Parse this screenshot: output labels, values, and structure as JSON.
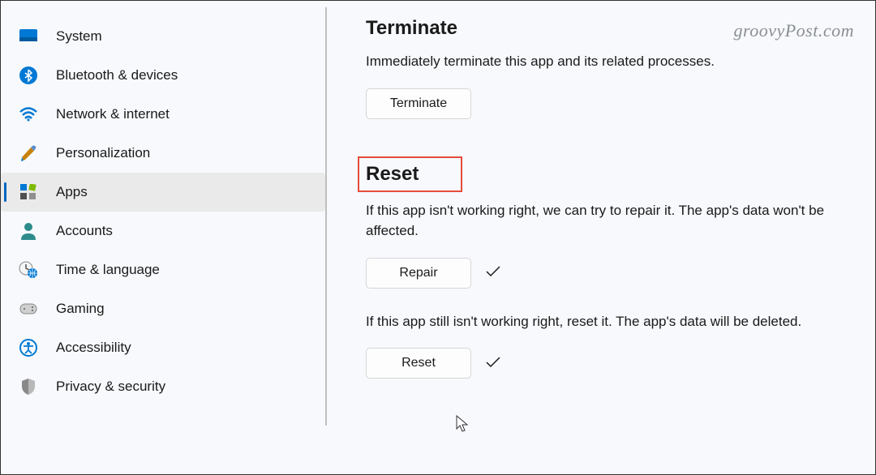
{
  "sidebar": {
    "items": [
      {
        "label": "System"
      },
      {
        "label": "Bluetooth & devices"
      },
      {
        "label": "Network & internet"
      },
      {
        "label": "Personalization"
      },
      {
        "label": "Apps"
      },
      {
        "label": "Accounts"
      },
      {
        "label": "Time & language"
      },
      {
        "label": "Gaming"
      },
      {
        "label": "Accessibility"
      },
      {
        "label": "Privacy & security"
      }
    ]
  },
  "content": {
    "terminate": {
      "title": "Terminate",
      "description": "Immediately terminate this app and its related processes.",
      "button": "Terminate"
    },
    "reset": {
      "title": "Reset",
      "repair_description": "If this app isn't working right, we can try to repair it. The app's data won't be affected.",
      "repair_button": "Repair",
      "reset_description": "If this app still isn't working right, reset it. The app's data will be deleted.",
      "reset_button": "Reset"
    }
  },
  "watermark": "groovyPost.com"
}
